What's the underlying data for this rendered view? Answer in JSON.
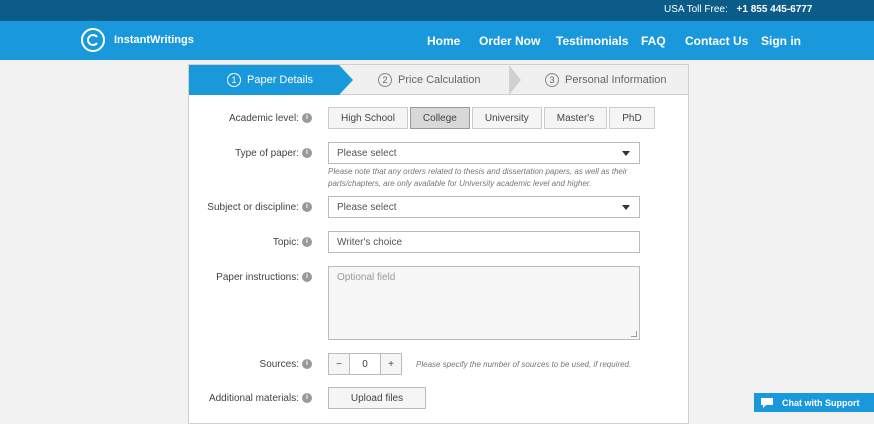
{
  "topbar": {
    "phone_label": "USA Toll Free:",
    "phone_number": "+1 855 445-6777"
  },
  "brand": {
    "name": "InstantWritings"
  },
  "nav": {
    "home": "Home",
    "order_now": "Order Now",
    "testimonials": "Testimonials",
    "faq": "FAQ",
    "contact": "Contact Us",
    "signin": "Sign in"
  },
  "steps": [
    {
      "num": "1",
      "label": "Paper Details"
    },
    {
      "num": "2",
      "label": "Price Calculation"
    },
    {
      "num": "3",
      "label": "Personal Information"
    }
  ],
  "form": {
    "academic_level_label": "Academic level:",
    "levels": [
      "High School",
      "College",
      "University",
      "Master's",
      "PhD"
    ],
    "type_label": "Type of paper:",
    "type_value": "Please select",
    "type_note_1": "Please note that any orders related to thesis and dissertation papers, as well as their",
    "type_note_2": "parts/chapters, are only available for University academic level and higher.",
    "subject_label": "Subject or discipline:",
    "subject_value": "Please select",
    "topic_label": "Topic:",
    "topic_value": "Writer's choice",
    "instructions_label": "Paper instructions:",
    "instructions_placeholder": "Optional field",
    "sources_label": "Sources:",
    "sources_minus": "−",
    "sources_value": "0",
    "sources_plus": "+",
    "sources_note": "Please specify the number of sources to be used, if required.",
    "materials_label": "Additional materials:",
    "upload_label": "Upload files"
  },
  "chat": {
    "label": "Chat with Support"
  },
  "info_glyph": "i"
}
